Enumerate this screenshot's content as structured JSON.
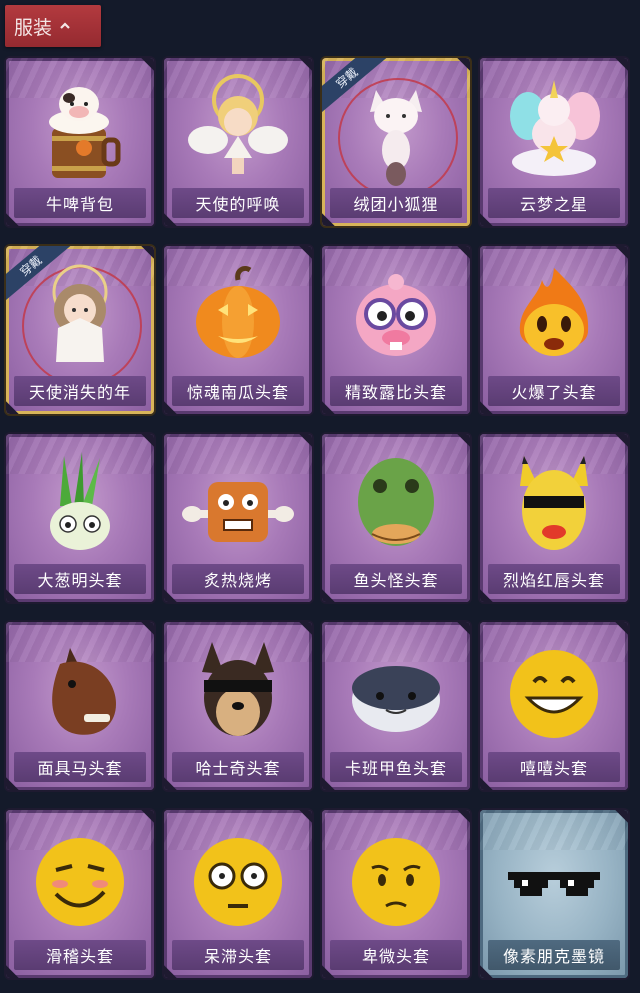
{
  "header": {
    "section_label": "服装"
  },
  "badges": {
    "worn": "穿戴"
  },
  "items": [
    {
      "name": "牛啤背包",
      "icon": "cow-beer-barrel-icon",
      "worn": false,
      "rarity": "purple"
    },
    {
      "name": "天使的呼唤",
      "icon": "angel-icon",
      "worn": false,
      "rarity": "purple"
    },
    {
      "name": "绒团小狐狸",
      "icon": "fox-icon",
      "worn": true,
      "rarity": "purple"
    },
    {
      "name": "云梦之星",
      "icon": "unicorn-cloud-icon",
      "worn": false,
      "rarity": "purple"
    },
    {
      "name": "天使消失的年",
      "icon": "angel-girl-icon",
      "worn": true,
      "rarity": "purple"
    },
    {
      "name": "惊魂南瓜头套",
      "icon": "pumpkin-icon",
      "worn": false,
      "rarity": "purple"
    },
    {
      "name": "精致露比头套",
      "icon": "pink-beaver-icon",
      "worn": false,
      "rarity": "purple"
    },
    {
      "name": "火爆了头套",
      "icon": "fire-face-icon",
      "worn": false,
      "rarity": "purple"
    },
    {
      "name": "大葱明头套",
      "icon": "scallion-icon",
      "worn": false,
      "rarity": "purple"
    },
    {
      "name": "炙热烧烤",
      "icon": "bbq-meat-icon",
      "worn": false,
      "rarity": "purple"
    },
    {
      "name": "鱼头怪头套",
      "icon": "fish-head-icon",
      "worn": false,
      "rarity": "purple"
    },
    {
      "name": "烈焰红唇头套",
      "icon": "yellow-mask-icon",
      "worn": false,
      "rarity": "purple"
    },
    {
      "name": "面具马头套",
      "icon": "horse-head-icon",
      "worn": false,
      "rarity": "purple"
    },
    {
      "name": "哈士奇头套",
      "icon": "husky-icon",
      "worn": false,
      "rarity": "purple"
    },
    {
      "name": "卡班甲鱼头套",
      "icon": "fish-ball-icon",
      "worn": false,
      "rarity": "purple"
    },
    {
      "name": "嘻嘻头套",
      "icon": "grin-emoji-icon",
      "worn": false,
      "rarity": "purple"
    },
    {
      "name": "滑稽头套",
      "icon": "smirk-emoji-icon",
      "worn": false,
      "rarity": "purple"
    },
    {
      "name": "呆滞头套",
      "icon": "blank-stare-emoji-icon",
      "worn": false,
      "rarity": "purple"
    },
    {
      "name": "卑微头套",
      "icon": "humble-emoji-icon",
      "worn": false,
      "rarity": "purple"
    },
    {
      "name": "像素朋克墨镜",
      "icon": "pixel-sunglasses-icon",
      "worn": false,
      "rarity": "blue"
    }
  ]
}
